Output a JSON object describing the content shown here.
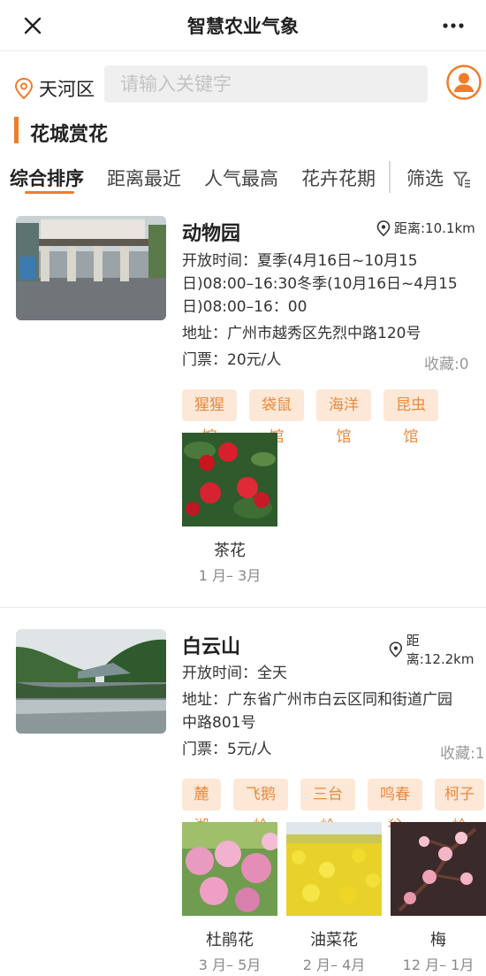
{
  "header": {
    "title": "智慧农业气象"
  },
  "location": {
    "district": "天河区"
  },
  "search": {
    "placeholder": "请输入关键字"
  },
  "section": {
    "title": "花城赏花"
  },
  "tabs": [
    "综合排序",
    "距离最近",
    "人气最高",
    "花卉花期"
  ],
  "filter": {
    "label": "筛选"
  },
  "accent_color": "#f07c2a",
  "places": [
    {
      "name": "动物园",
      "distance": "距离:10.1km",
      "hours_lines": [
        "开放时间：夏季(4月16日~10月15",
        "日)08:00–16:30冬季(10月16日~4月15",
        "日)08:00–16：00"
      ],
      "address_lines": [
        "地址：广州市越秀区先烈中路120号"
      ],
      "ticket": "门票：20元/人",
      "favorites": "收藏:0",
      "tags": [
        "猩猩馆",
        "袋鼠馆",
        "海洋馆",
        "昆虫馆"
      ],
      "flowers": [
        {
          "name": "茶花",
          "period": "1 月– 3月"
        }
      ]
    },
    {
      "name": "白云山",
      "distance": "距离:12.2km",
      "hours_lines": [
        "开放时间：全天"
      ],
      "address_lines": [
        "地址：广东省广州市白云区同和街道广园",
        "中路801号"
      ],
      "ticket": "门票：5元/人",
      "favorites": "收藏:1",
      "tags": [
        "麓湖",
        "飞鹅岭",
        "三台岭",
        "鸣春谷",
        "柯子岭"
      ],
      "flowers": [
        {
          "name": "杜鹃花",
          "period": "3 月– 5月"
        },
        {
          "name": "油菜花",
          "period": "2 月– 4月"
        },
        {
          "name": "梅",
          "period": "12 月– 1月"
        }
      ]
    }
  ]
}
